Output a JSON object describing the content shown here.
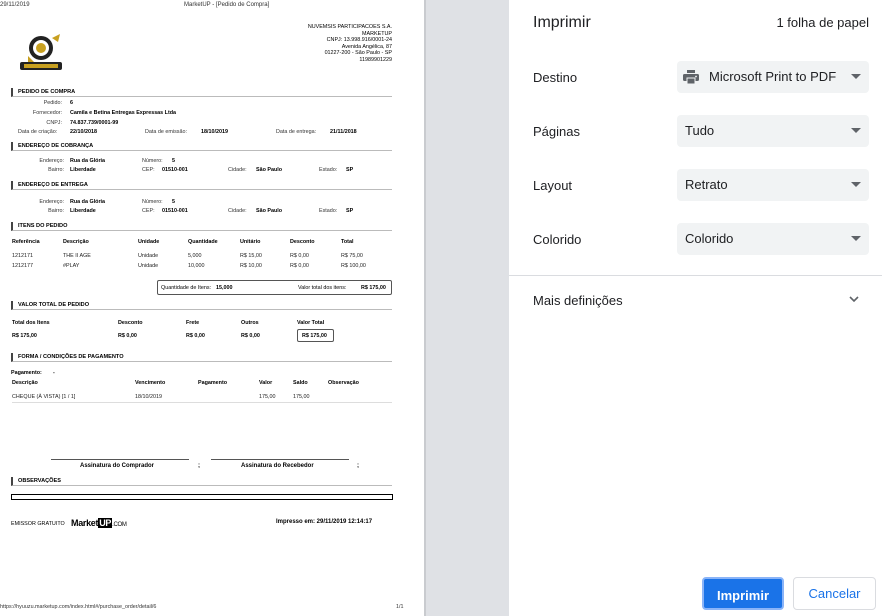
{
  "page_header": {
    "date": "29/11/2019",
    "title": "MarketUP - [Pedido de Compra]"
  },
  "company": {
    "name": "NUVEMSIS PARTICIPACOES S.A.",
    "brand": "MARKETUP",
    "cnpj": "CNPJ: 13.998.916/0001-24",
    "street": "Avenida Angélica, 87",
    "city": "01227-200 - São Paulo - SP",
    "phone": "11989901229"
  },
  "order": {
    "section": "PEDIDO DE COMPRA",
    "pedido_label": "Pedido:",
    "pedido_value": "6",
    "fornecedor_label": "Fornecedor:",
    "fornecedor_value": "Camila e Betina Entregas Expressas Ltda",
    "cnpj_label": "CNPJ:",
    "cnpj_value": "74.837.739/0001-99",
    "criacao_label": "Data de criação:",
    "criacao_value": "22/10/2018",
    "emissao_label": "Data de emissão:",
    "emissao_value": "18/10/2019",
    "entrega_label": "Data de entrega:",
    "entrega_value": "21/11/2018"
  },
  "billing": {
    "section": "ENDEREÇO DE COBRANÇA",
    "endereco_label": "Endereço:",
    "endereco_value": "Rua da Glória",
    "numero_label": "Número:",
    "numero_value": "5",
    "bairro_label": "Bairro:",
    "bairro_value": "Liberdade",
    "cep_label": "CEP:",
    "cep_value": "01510-001",
    "cidade_label": "Cidade:",
    "cidade_value": "São Paulo",
    "estado_label": "Estado:",
    "estado_value": "SP"
  },
  "delivery": {
    "section": "ENDEREÇO DE ENTREGA",
    "endereco_label": "Endereço:",
    "endereco_value": "Rua da Glória",
    "numero_label": "Número:",
    "numero_value": "5",
    "bairro_label": "Bairro:",
    "bairro_value": "Liberdade",
    "cep_label": "CEP:",
    "cep_value": "01510-001",
    "cidade_label": "Cidade:",
    "cidade_value": "São Paulo",
    "estado_label": "Estado:",
    "estado_value": "SP"
  },
  "items": {
    "section": "ITENS DO PEDIDO",
    "headers": [
      "Referência",
      "Descrição",
      "Unidade",
      "Quantidade",
      "Unitário",
      "Desconto",
      "Total"
    ],
    "rows": [
      [
        "1212171",
        "THE II AGE",
        "Unidade",
        "5,000",
        "R$ 15,00",
        "R$ 0,00",
        "R$ 75,00"
      ],
      [
        "1212177",
        "#PLAY",
        "Unidade",
        "10,000",
        "R$ 10,00",
        "R$ 0,00",
        "R$ 100,00"
      ]
    ],
    "qty_label": "Quantidade de Itens:",
    "qty_value": "15,000",
    "total_label": "Valor total dos itens:",
    "total_value": "R$ 175,00"
  },
  "totals": {
    "section": "VALOR TOTAL DE PEDIDO",
    "headers": [
      "Total dos Itens",
      "Desconto",
      "Frete",
      "Outros",
      "Valor Total"
    ],
    "values": [
      "R$ 175,00",
      "R$ 0,00",
      "R$ 0,00",
      "R$ 0,00",
      "R$ 175,00"
    ]
  },
  "payment": {
    "section": "FORMA / CONDIÇÕES DE PAGAMENTO",
    "pagamento_label": "Pagamento:",
    "pagamento_value": "-",
    "headers": [
      "Descrição",
      "Vencimento",
      "Pagamento",
      "Valor",
      "Saldo",
      "Observação"
    ],
    "row": [
      "CHEQUE (À VISTA) [1 / 1]",
      "18/10/2019",
      "",
      "175,00",
      "175,00",
      ""
    ]
  },
  "signatures": {
    "buyer": "Assinatura do Comprador",
    "receiver": "Assinatura do Recebedor",
    "sep": ";"
  },
  "observations": {
    "section": "OBSERVAÇÕES"
  },
  "footer": {
    "emissor": "EMISSOR GRATUITO",
    "brand_a": "Market",
    "brand_b": "UP",
    "brand_c": ".COM",
    "printed": "Impresso em: 29/11/2019 12:14:17",
    "url": "https://hyuuzu.marketup.com/index.html#/purchase_order/detail/6",
    "page": "1/1"
  },
  "panel": {
    "title": "Imprimir",
    "sheets": "1 folha de papel",
    "destino_label": "Destino",
    "destino_value": "Microsoft Print to PDF",
    "paginas_label": "Páginas",
    "paginas_value": "Tudo",
    "layout_label": "Layout",
    "layout_value": "Retrato",
    "colorido_label": "Colorido",
    "colorido_value": "Colorido",
    "more_label": "Mais definições",
    "print_button": "Imprimir",
    "cancel_button": "Cancelar"
  },
  "colors": {
    "accent": "#1a73e8",
    "gutter": "#dfe1e5",
    "select_bg": "#f1f3f4"
  },
  "icons": [
    "printer-icon",
    "chevron-down-icon",
    "caret-down-icon",
    "company-logo"
  ]
}
